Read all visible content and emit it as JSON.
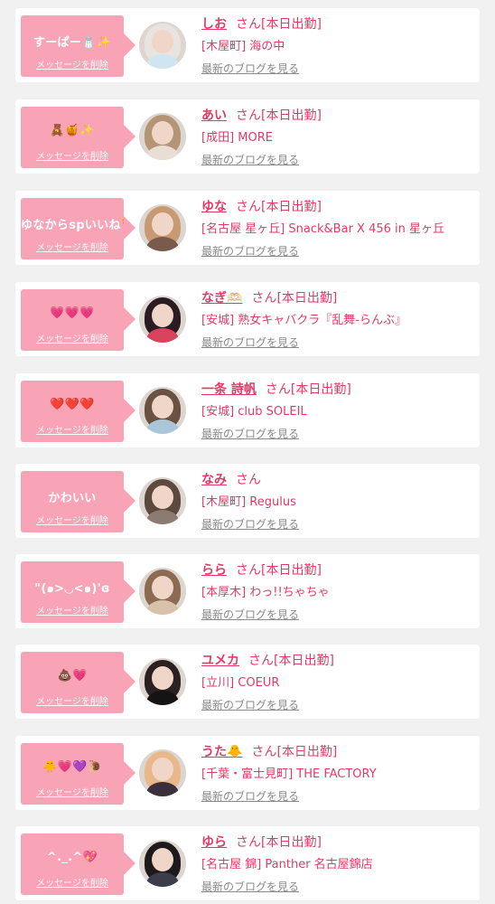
{
  "colors": {
    "accent": "#e23a66",
    "bubble": "#f9a3b6",
    "link": "#8a8a8a"
  },
  "labels": {
    "delete": "メッセージを削除",
    "san": "さん",
    "blog": "最新のブログを見る"
  },
  "messages": [
    {
      "message": "すーぱー🧂✨",
      "name": "しお",
      "status": "[本日出勤]",
      "shop": "[木屋町] 海の中",
      "avatar_hair": "#e9e4df",
      "avatar_body": "#cfe6f1"
    },
    {
      "message": "🧸🍯✨",
      "name": "あい",
      "status": "[本日出勤]",
      "shop": "[成田] MORE",
      "avatar_hair": "#b39474",
      "avatar_body": "#e8ded6"
    },
    {
      "message": "ゆなからspいいね💘🎀",
      "name": "ゆな",
      "status": "[本日出勤]",
      "shop": "[名古屋 星ヶ丘] Snack&Bar X 456 in 星ヶ丘",
      "avatar_hair": "#c79a73",
      "avatar_body": "#7a5a4a"
    },
    {
      "message": "💗💗💗",
      "name": "なぎ🫶🏻",
      "status": "[本日出勤]",
      "shop": "[安城] 熟女キャバクラ『乱舞-らんぶ』",
      "avatar_hair": "#2a1c22",
      "avatar_body": "#d9425c"
    },
    {
      "message": "❤️❤️❤️",
      "name": "一条 詩帆",
      "status": "[本日出勤]",
      "shop": "[安城] club SOLEIL",
      "avatar_hair": "#6b5142",
      "avatar_body": "#a9c7d8"
    },
    {
      "message": "かわいい",
      "name": "なみ",
      "status": "",
      "shop": "[木屋町] Regulus",
      "avatar_hair": "#5c4a3f",
      "avatar_body": "#8c7b70"
    },
    {
      "message": "\"(๑>◡<๑)'ɞ",
      "name": "らら",
      "status": "[本日出勤]",
      "shop": "[本厚木] わっ!!ちゃちゃ",
      "avatar_hair": "#8d6b52",
      "avatar_body": "#d8c2aa"
    },
    {
      "message": "💩💗",
      "name": "ユメカ",
      "status": "[本日出勤]",
      "shop": "[立川] COEUR",
      "avatar_hair": "#2a2120",
      "avatar_body": "#141414"
    },
    {
      "message": "🐥💗💜🐌",
      "name": "うた🐥",
      "status": "[本日出勤]",
      "shop": "[千葉・富士見町] THE FACTORY",
      "avatar_hair": "#e8b88a",
      "avatar_body": "#3a2f3a"
    },
    {
      "message": "^._.^💖",
      "name": "ゆら",
      "status": "[本日出勤]",
      "shop": "[名古屋 錦] Panther 名古屋錦店",
      "avatar_hair": "#1e1a1c",
      "avatar_body": "#3c3c4a"
    }
  ]
}
